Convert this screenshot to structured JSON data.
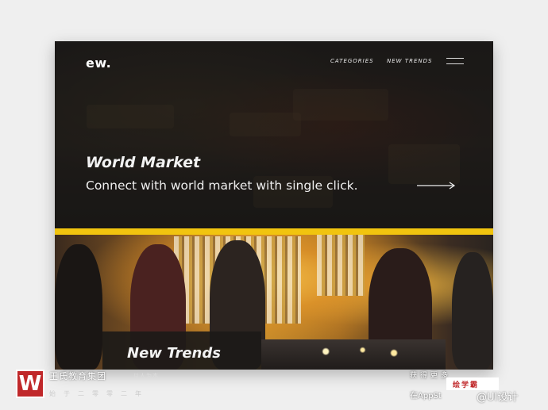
{
  "header": {
    "logo": "ew.",
    "nav": [
      {
        "label": "CATEGORIES"
      },
      {
        "label": "NEW TRENDS"
      }
    ],
    "menu_icon": "hamburger-menu-icon"
  },
  "hero": {
    "title": "World Market",
    "subtitle": "Connect with world market with single click.",
    "arrow_icon": "arrow-right-icon"
  },
  "section": {
    "title": "New Trends"
  },
  "watermarks": {
    "logo_letter": "W",
    "org_name": "王氏教育集团",
    "org_tag": "以人为本",
    "org_line": "始于二零零二年",
    "app_line1": "获得更多",
    "app_line2": "在AppSt",
    "badge": "绘学霸",
    "weibo": "@UI设计"
  },
  "colors": {
    "accent_yellow": "#f1c40f",
    "card_dark": "#1d1b19",
    "background": "#efefef",
    "watermark_red": "#c0282a"
  }
}
